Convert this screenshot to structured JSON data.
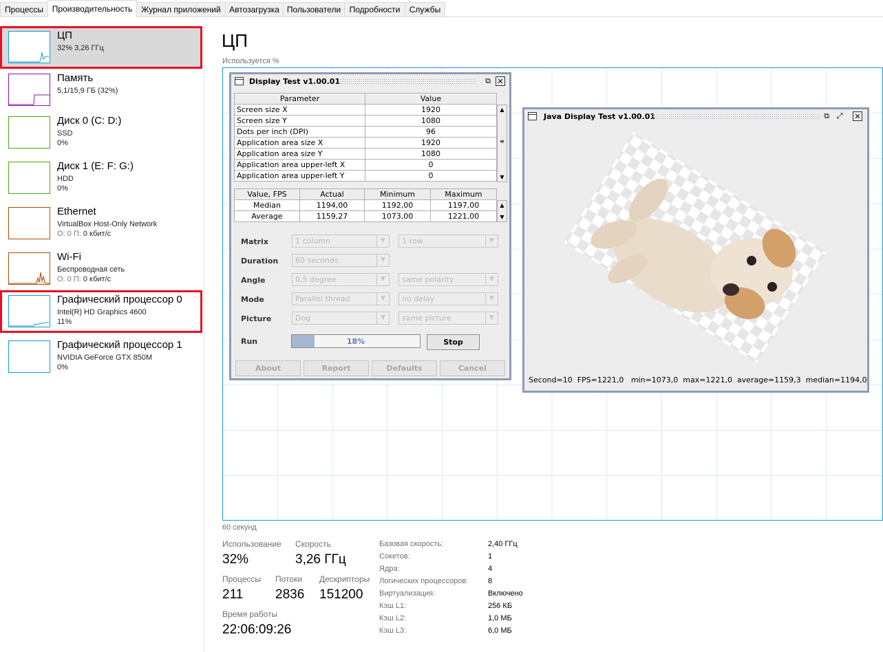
{
  "tabs": [
    "Процессы",
    "Производительность",
    "Журнал приложений",
    "Автозагрузка",
    "Пользователи",
    "Подробности",
    "Службы"
  ],
  "sidebar": {
    "items": [
      {
        "name": "ЦП",
        "sub": "32% 3,26 ГГц",
        "sub2": ""
      },
      {
        "name": "Память",
        "sub": "5,1/15,9 ГБ (32%)",
        "sub2": ""
      },
      {
        "name": "Диск 0 (C: D:)",
        "sub": "SSD",
        "sub2": "0%"
      },
      {
        "name": "Диск 1 (E: F: G:)",
        "sub": "HDD",
        "sub2": "0%"
      },
      {
        "name": "Ethernet",
        "sub": "VirtualBox Host-Only Network",
        "sub2_grey": "О: 0 П:",
        "sub2": "0 кбит/с"
      },
      {
        "name": "Wi-Fi",
        "sub": "Беспроводная сеть",
        "sub2_grey": "О: 0 П:",
        "sub2": "0 кбит/с"
      },
      {
        "name": "Графический процессор 0",
        "sub": "Intel(R) HD Graphics 4600",
        "sub2": "11%"
      },
      {
        "name": "Графический процессор 1",
        "sub": "NVIDIA GeForce GTX 850M",
        "sub2": "0%"
      }
    ]
  },
  "main": {
    "title": "ЦП",
    "usage_label": "Используется %",
    "time_label": "60 секунд",
    "stats": {
      "usage_label": "Использование",
      "usage": "32%",
      "speed_label": "Скорость",
      "speed": "3,26 ГГц",
      "processes_label": "Процессы",
      "processes": "211",
      "threads_label": "Потоки",
      "threads": "2836",
      "handles_label": "Дескрипторы",
      "handles": "151200",
      "uptime_label": "Время работы",
      "uptime": "22:06:09:26"
    },
    "details": [
      {
        "k": "Базовая скорость:",
        "v": "2,40 ГГц"
      },
      {
        "k": "Сокетов:",
        "v": "1"
      },
      {
        "k": "Ядра:",
        "v": "4"
      },
      {
        "k": "Логических процессоров:",
        "v": "8"
      },
      {
        "k": "Виртуализация:",
        "v": "Включено"
      },
      {
        "k": "Кэш L1:",
        "v": "256 КБ"
      },
      {
        "k": "Кэш L2:",
        "v": "1,0 МБ"
      },
      {
        "k": "Кэш L3:",
        "v": "6,0 МБ"
      }
    ]
  },
  "display_test": {
    "title": "Display Test v1.00.01",
    "param_headers": [
      "Parameter",
      "Value"
    ],
    "params": [
      [
        "Screen size X",
        "1920"
      ],
      [
        "Screen size Y",
        "1080"
      ],
      [
        "Dots per inch (DPI)",
        "96"
      ],
      [
        "Application area size X",
        "1920"
      ],
      [
        "Application area size Y",
        "1080"
      ],
      [
        "Application area upper-left X",
        "0"
      ],
      [
        "Application area upper-left Y",
        "0"
      ]
    ],
    "fps_headers": [
      "Value, FPS",
      "Actual",
      "Minimum",
      "Maximum"
    ],
    "fps": [
      [
        "Median",
        "1194,00",
        "1192,00",
        "1197,00"
      ],
      [
        "Average",
        "1159,27",
        "1073,00",
        "1221,00"
      ]
    ],
    "controls": {
      "matrix_label": "Matrix",
      "matrix_a": "1 column",
      "matrix_b": "1 row",
      "duration_label": "Duration",
      "duration": "60 seconds",
      "angle_label": "Angle",
      "angle_a": "0,5 degree",
      "angle_b": "same polarity",
      "mode_label": "Mode",
      "mode_a": "Parallel thread",
      "mode_b": "no delay",
      "picture_label": "Picture",
      "picture_a": "Dog",
      "picture_b": "same picture",
      "run_label": "Run",
      "progress_text": "18%",
      "progress": 0.18,
      "stop": "Stop"
    },
    "buttons": [
      "About",
      "Report",
      "Defaults",
      "Cancel"
    ]
  },
  "java_test": {
    "title": "Java Display Test v1.00.01",
    "status": "Second=10  FPS=1221,0   min=1073,0  max=1221,0  average=1159,3  median=1194,0"
  }
}
